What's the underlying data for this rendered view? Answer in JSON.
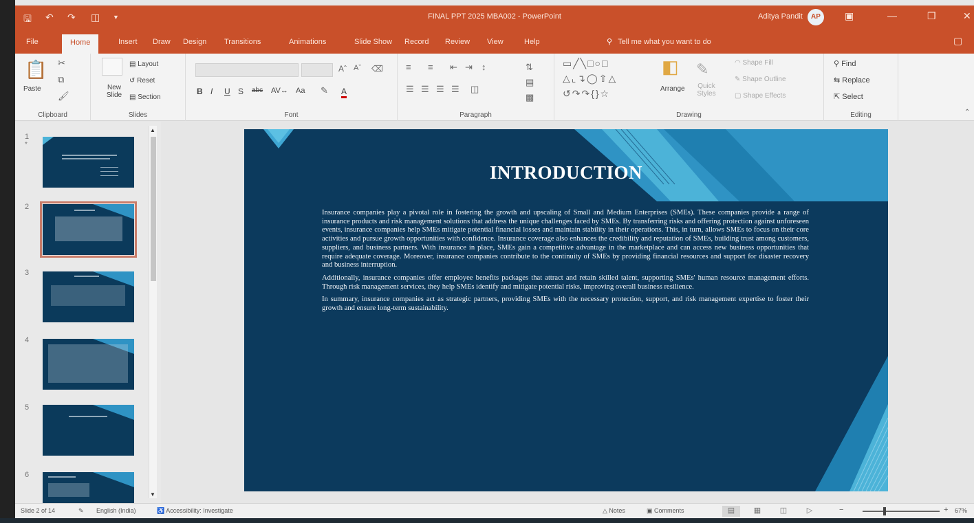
{
  "window": {
    "title": "FINAL PPT 2025 MBA002 - PowerPoint",
    "user_name": "Aditya Pandit",
    "user_initials": "AP",
    "accent_color": "#c9502a"
  },
  "quick_access": {
    "icons": [
      "save-icon",
      "undo-icon",
      "redo-icon",
      "present-from-start-icon",
      "customize-icon"
    ]
  },
  "tabs": [
    {
      "label": "File"
    },
    {
      "label": "Home"
    },
    {
      "label": "Insert"
    },
    {
      "label": "Draw"
    },
    {
      "label": "Design"
    },
    {
      "label": "Transitions"
    },
    {
      "label": "Animations"
    },
    {
      "label": "Slide Show"
    },
    {
      "label": "Record"
    },
    {
      "label": "Review"
    },
    {
      "label": "View"
    },
    {
      "label": "Help"
    }
  ],
  "active_tab": "Home",
  "tell_me": "Tell me what you want to do",
  "ribbon": {
    "clipboard": {
      "label": "Clipboard",
      "paste": "Paste"
    },
    "slides": {
      "label": "Slides",
      "new_slide": "New Slide",
      "layout": "Layout",
      "reset": "Reset",
      "section": "Section"
    },
    "font": {
      "label": "Font",
      "bold": "B",
      "italic": "I",
      "underline": "U",
      "strike": "S",
      "change_case": "Aa"
    },
    "paragraph": {
      "label": "Paragraph"
    },
    "drawing": {
      "label": "Drawing",
      "arrange": "Arrange",
      "quick_styles": "Quick Styles",
      "shape_fill": "Shape Fill",
      "shape_outline": "Shape Outline",
      "shape_effects": "Shape Effects"
    },
    "editing": {
      "label": "Editing",
      "find": "Find",
      "replace": "Replace",
      "select": "Select"
    }
  },
  "thumbnails": [
    {
      "number": "1",
      "star": "*"
    },
    {
      "number": "2"
    },
    {
      "number": "3"
    },
    {
      "number": "4"
    },
    {
      "number": "5"
    },
    {
      "number": "6"
    }
  ],
  "selected_slide": 2,
  "slide": {
    "title": "INTRODUCTION",
    "paragraphs": [
      "Insurance companies play a pivotal role in fostering the growth and upscaling of Small and Medium Enterprises (SMEs). These companies provide a range of insurance products and risk management solutions that address the unique challenges faced by SMEs. By transferring risks and offering protection against unforeseen events, insurance companies help SMEs mitigate potential financial losses and maintain stability in their operations. This, in turn, allows SMEs to focus on their core activities and pursue growth opportunities with confidence. Insurance coverage also enhances the credibility and reputation of SMEs, building trust among customers, suppliers, and business partners. With insurance in place, SMEs gain a competitive advantage in the marketplace and can access new business opportunities that require adequate coverage. Moreover, insurance companies contribute to the continuity of SMEs by providing financial resources and support for disaster recovery and business interruption.",
      "Additionally, insurance companies offer employee benefits packages that attract and retain skilled talent, supporting SMEs' human resource management efforts. Through risk management services, they help SMEs identify and mitigate potential risks, improving overall business resilience.",
      "In summary, insurance companies act as strategic partners, providing SMEs with the necessary protection, support, and risk management expertise to foster their growth and ensure long-term sustainability."
    ],
    "colors": {
      "background": "#0c3a5d",
      "accent": "#2f93c4",
      "accent_light": "#4cb3d8"
    }
  },
  "status": {
    "slide_indicator": "Slide 2 of 14",
    "language": "English (India)",
    "accessibility": "Accessibility: Investigate",
    "notes": "Notes",
    "comments": "Comments",
    "zoom": "67%"
  }
}
